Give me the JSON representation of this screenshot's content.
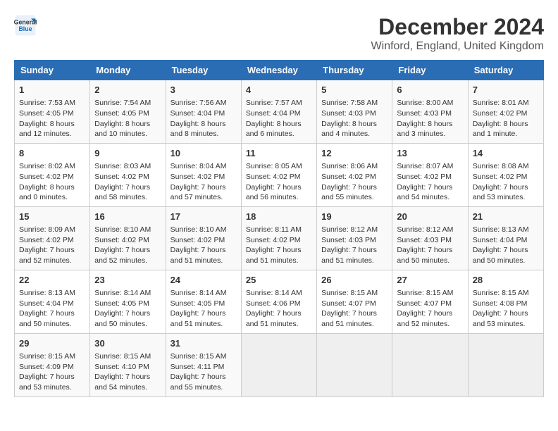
{
  "header": {
    "logo_line1": "General",
    "logo_line2": "Blue",
    "month_title": "December 2024",
    "location": "Winford, England, United Kingdom"
  },
  "weekdays": [
    "Sunday",
    "Monday",
    "Tuesday",
    "Wednesday",
    "Thursday",
    "Friday",
    "Saturday"
  ],
  "weeks": [
    [
      {
        "day": 1,
        "info": "Sunrise: 7:53 AM\nSunset: 4:05 PM\nDaylight: 8 hours\nand 12 minutes."
      },
      {
        "day": 2,
        "info": "Sunrise: 7:54 AM\nSunset: 4:05 PM\nDaylight: 8 hours\nand 10 minutes."
      },
      {
        "day": 3,
        "info": "Sunrise: 7:56 AM\nSunset: 4:04 PM\nDaylight: 8 hours\nand 8 minutes."
      },
      {
        "day": 4,
        "info": "Sunrise: 7:57 AM\nSunset: 4:04 PM\nDaylight: 8 hours\nand 6 minutes."
      },
      {
        "day": 5,
        "info": "Sunrise: 7:58 AM\nSunset: 4:03 PM\nDaylight: 8 hours\nand 4 minutes."
      },
      {
        "day": 6,
        "info": "Sunrise: 8:00 AM\nSunset: 4:03 PM\nDaylight: 8 hours\nand 3 minutes."
      },
      {
        "day": 7,
        "info": "Sunrise: 8:01 AM\nSunset: 4:02 PM\nDaylight: 8 hours\nand 1 minute."
      }
    ],
    [
      {
        "day": 8,
        "info": "Sunrise: 8:02 AM\nSunset: 4:02 PM\nDaylight: 8 hours\nand 0 minutes."
      },
      {
        "day": 9,
        "info": "Sunrise: 8:03 AM\nSunset: 4:02 PM\nDaylight: 7 hours\nand 58 minutes."
      },
      {
        "day": 10,
        "info": "Sunrise: 8:04 AM\nSunset: 4:02 PM\nDaylight: 7 hours\nand 57 minutes."
      },
      {
        "day": 11,
        "info": "Sunrise: 8:05 AM\nSunset: 4:02 PM\nDaylight: 7 hours\nand 56 minutes."
      },
      {
        "day": 12,
        "info": "Sunrise: 8:06 AM\nSunset: 4:02 PM\nDaylight: 7 hours\nand 55 minutes."
      },
      {
        "day": 13,
        "info": "Sunrise: 8:07 AM\nSunset: 4:02 PM\nDaylight: 7 hours\nand 54 minutes."
      },
      {
        "day": 14,
        "info": "Sunrise: 8:08 AM\nSunset: 4:02 PM\nDaylight: 7 hours\nand 53 minutes."
      }
    ],
    [
      {
        "day": 15,
        "info": "Sunrise: 8:09 AM\nSunset: 4:02 PM\nDaylight: 7 hours\nand 52 minutes."
      },
      {
        "day": 16,
        "info": "Sunrise: 8:10 AM\nSunset: 4:02 PM\nDaylight: 7 hours\nand 52 minutes."
      },
      {
        "day": 17,
        "info": "Sunrise: 8:10 AM\nSunset: 4:02 PM\nDaylight: 7 hours\nand 51 minutes."
      },
      {
        "day": 18,
        "info": "Sunrise: 8:11 AM\nSunset: 4:02 PM\nDaylight: 7 hours\nand 51 minutes."
      },
      {
        "day": 19,
        "info": "Sunrise: 8:12 AM\nSunset: 4:03 PM\nDaylight: 7 hours\nand 51 minutes."
      },
      {
        "day": 20,
        "info": "Sunrise: 8:12 AM\nSunset: 4:03 PM\nDaylight: 7 hours\nand 50 minutes."
      },
      {
        "day": 21,
        "info": "Sunrise: 8:13 AM\nSunset: 4:04 PM\nDaylight: 7 hours\nand 50 minutes."
      }
    ],
    [
      {
        "day": 22,
        "info": "Sunrise: 8:13 AM\nSunset: 4:04 PM\nDaylight: 7 hours\nand 50 minutes."
      },
      {
        "day": 23,
        "info": "Sunrise: 8:14 AM\nSunset: 4:05 PM\nDaylight: 7 hours\nand 50 minutes."
      },
      {
        "day": 24,
        "info": "Sunrise: 8:14 AM\nSunset: 4:05 PM\nDaylight: 7 hours\nand 51 minutes."
      },
      {
        "day": 25,
        "info": "Sunrise: 8:14 AM\nSunset: 4:06 PM\nDaylight: 7 hours\nand 51 minutes."
      },
      {
        "day": 26,
        "info": "Sunrise: 8:15 AM\nSunset: 4:07 PM\nDaylight: 7 hours\nand 51 minutes."
      },
      {
        "day": 27,
        "info": "Sunrise: 8:15 AM\nSunset: 4:07 PM\nDaylight: 7 hours\nand 52 minutes."
      },
      {
        "day": 28,
        "info": "Sunrise: 8:15 AM\nSunset: 4:08 PM\nDaylight: 7 hours\nand 53 minutes."
      }
    ],
    [
      {
        "day": 29,
        "info": "Sunrise: 8:15 AM\nSunset: 4:09 PM\nDaylight: 7 hours\nand 53 minutes."
      },
      {
        "day": 30,
        "info": "Sunrise: 8:15 AM\nSunset: 4:10 PM\nDaylight: 7 hours\nand 54 minutes."
      },
      {
        "day": 31,
        "info": "Sunrise: 8:15 AM\nSunset: 4:11 PM\nDaylight: 7 hours\nand 55 minutes."
      },
      null,
      null,
      null,
      null
    ]
  ]
}
